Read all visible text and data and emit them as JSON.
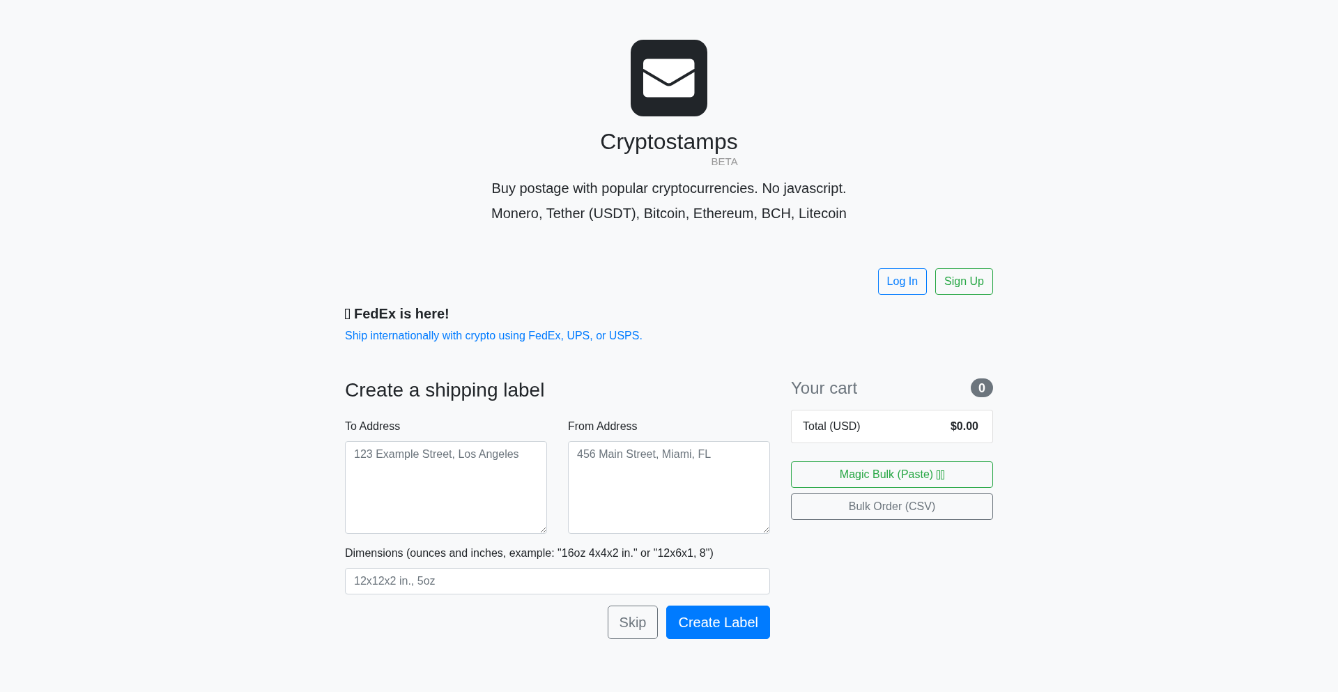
{
  "header": {
    "title": "Cryptostamps",
    "badge": "BETA",
    "taglines": [
      "Buy postage with popular cryptocurrencies. No javascript.",
      "Monero, Tether (USDT), Bitcoin, Ethereum, BCH, Litecoin"
    ]
  },
  "auth_buttons": [
    {
      "label": "Log In",
      "kind": "outline-primary"
    },
    {
      "label": "Sign Up",
      "kind": "outline-success"
    }
  ],
  "announcement": {
    "title": "FedEx is here!",
    "link": "Ship internationally with crypto using FedEx, UPS, or USPS."
  },
  "form": {
    "title": "Create a shipping label",
    "fields": [
      {
        "kind": "textarea",
        "label": "To Address",
        "placeholder": "123 Example Street, Los Angeles"
      },
      {
        "kind": "textarea",
        "label": "From Address",
        "placeholder": "456 Main Street, Miami, FL"
      },
      {
        "kind": "input",
        "label": "Dimensions (ounces and inches, example: \"16oz 4x4x2 in.\" or \"12x6x1, 8\")",
        "placeholder": "12x12x2 in., 5oz"
      }
    ],
    "buttons": [
      {
        "label": "Skip",
        "kind": "outline-secondary"
      },
      {
        "label": "Create Label",
        "kind": "primary"
      }
    ]
  },
  "cart": {
    "title": "Your cart",
    "count": "0",
    "total_label": "Total (USD)",
    "total_value": "$0.00",
    "buttons": [
      {
        "label": "Magic Bulk (Paste)",
        "kind": "outline-success",
        "icon": true
      },
      {
        "label": "Bulk Order (CSV)",
        "kind": "outline-secondary",
        "icon": false
      }
    ]
  }
}
